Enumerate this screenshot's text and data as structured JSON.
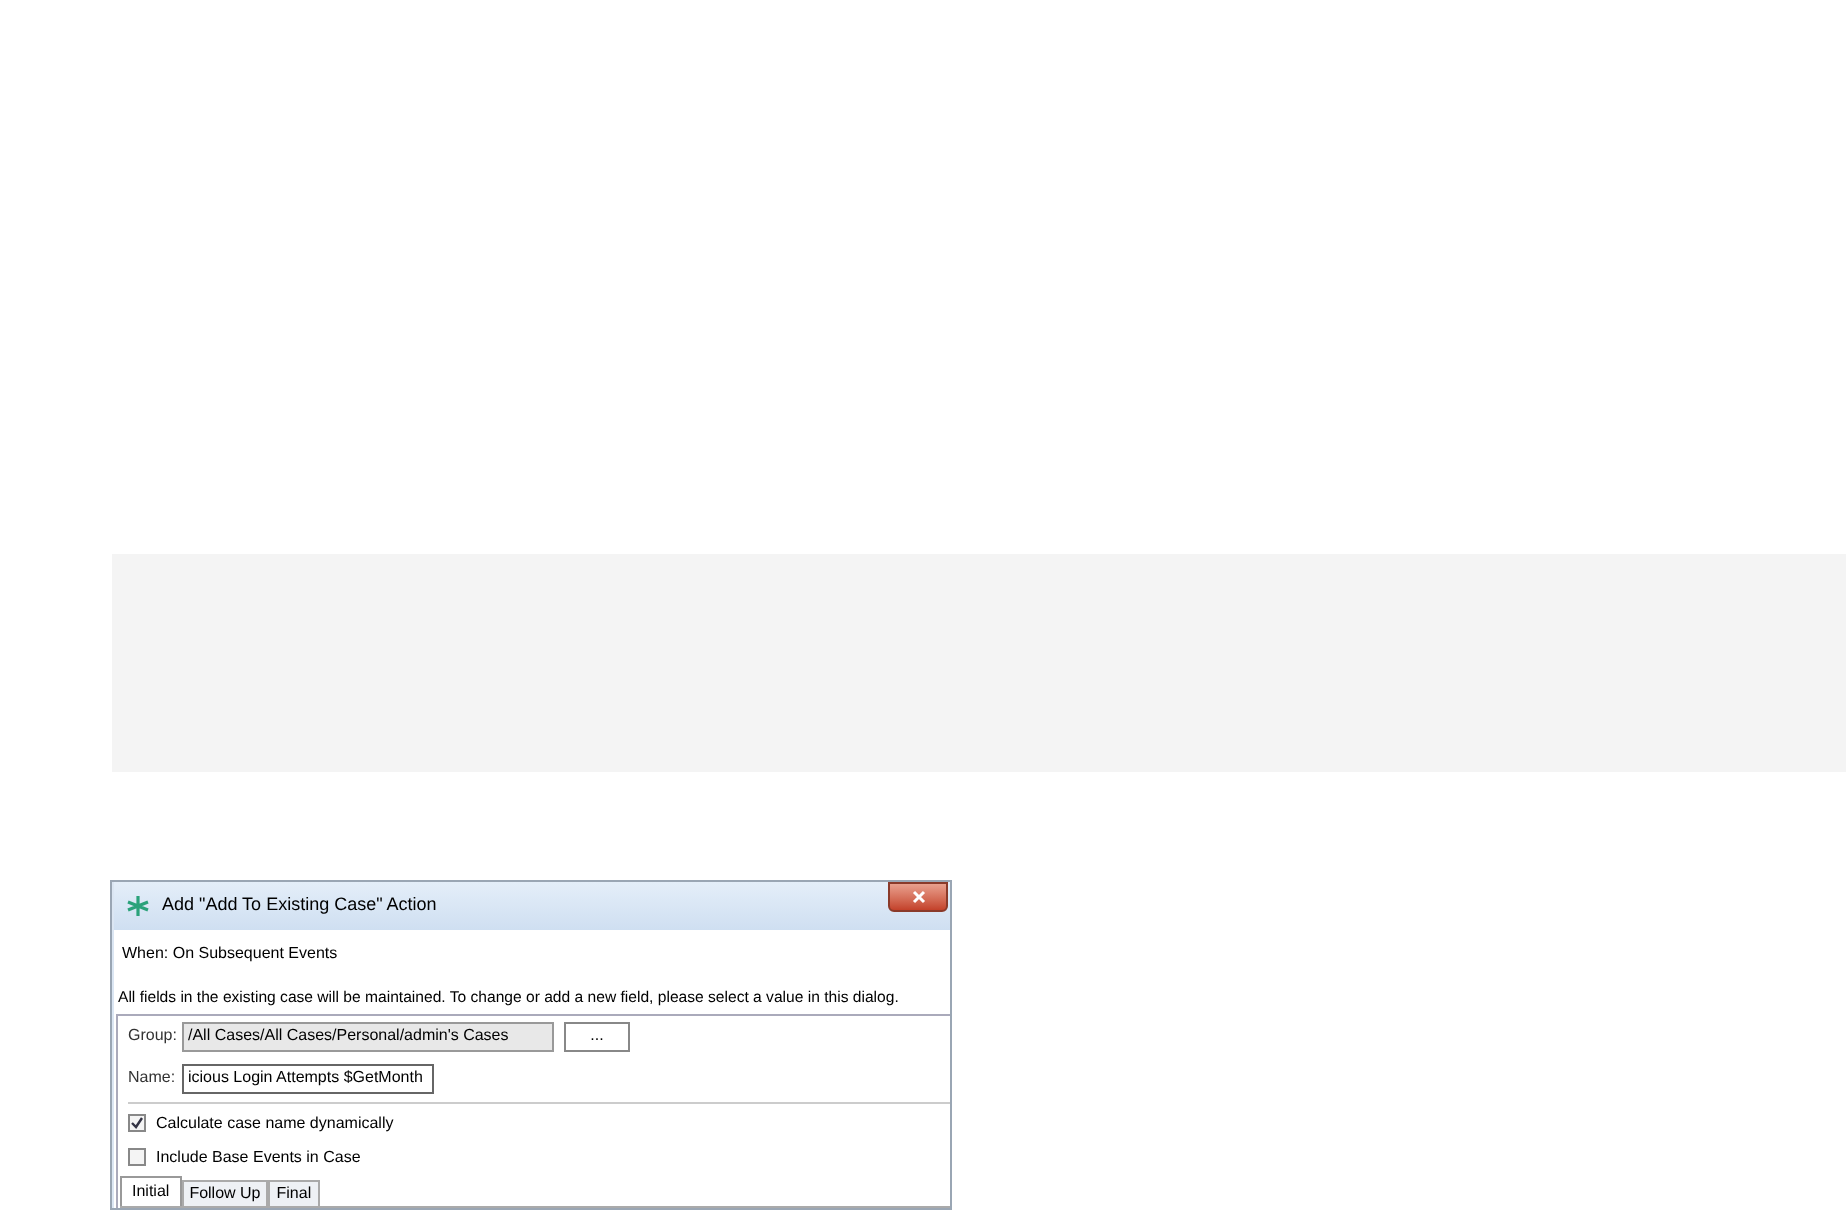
{
  "dialog": {
    "title": "Add \"Add To Existing Case\" Action",
    "when": "When: On Subsequent Events",
    "info": "All fields in the existing case will be maintained. To change or add a new field, please select a value in this dialog.",
    "group": {
      "label": "Group:",
      "value": "/All Cases/All Cases/Personal/admin's Cases",
      "browse": "..."
    },
    "name": {
      "label": "Name:",
      "value": "icious Login Attempts $GetMonth"
    },
    "checkboxes": [
      {
        "label": "Calculate case name dynamically",
        "checked": true
      },
      {
        "label": "Include Base Events in Case",
        "checked": false
      }
    ],
    "tabs": [
      {
        "label": "Initial",
        "selected": true
      },
      {
        "label": "Follow Up",
        "selected": false
      },
      {
        "label": "Final",
        "selected": false
      }
    ]
  }
}
